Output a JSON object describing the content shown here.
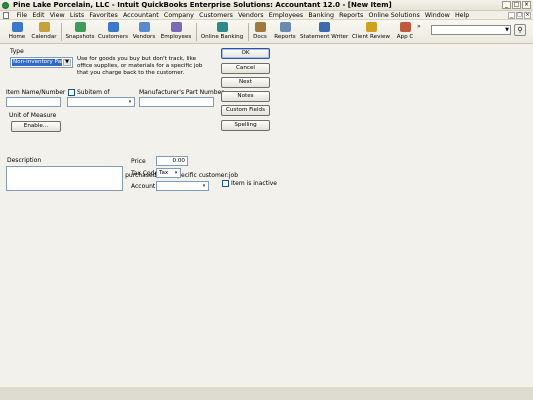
{
  "window": {
    "title": "Pine Lake Porcelain, LLC  -  Intuit QuickBooks Enterprise Solutions: Accountant 12.0 - [New Item]",
    "controls": [
      "_",
      "□",
      "×"
    ],
    "mdi_controls": [
      "_",
      "□",
      "×"
    ]
  },
  "menu": [
    "File",
    "Edit",
    "View",
    "Lists",
    "Favorites",
    "Accountant",
    "Company",
    "Customers",
    "Vendors",
    "Employees",
    "Banking",
    "Reports",
    "Online Solutions",
    "Window",
    "Help"
  ],
  "toolbar": {
    "items": [
      {
        "label": "Home",
        "color": "#3c78c8"
      },
      {
        "label": "Calendar",
        "color": "#c8a03c"
      },
      {
        "label": "Snapshots",
        "color": "#3c9e5a"
      },
      {
        "label": "Customers",
        "color": "#3c7ac8"
      },
      {
        "label": "Vendors",
        "color": "#5a8ad0"
      },
      {
        "label": "Employees",
        "color": "#7a6ab8"
      },
      {
        "label": "Online Banking",
        "color": "#2e8a8a"
      },
      {
        "label": "Docs",
        "color": "#a07a3c"
      },
      {
        "label": "Reports",
        "color": "#6a8ab0"
      },
      {
        "label": "Statement Writer",
        "color": "#3c6ab0"
      },
      {
        "label": "Client Review",
        "color": "#d0a020"
      },
      {
        "label": "App C",
        "color": "#c05a3c"
      }
    ],
    "overflow": "»",
    "search_value": ""
  },
  "form": {
    "type_label": "Type",
    "type_value": "Non-inventory Part",
    "type_description": "Use for goods you buy but don't track, like office supplies, or materials for a specific job that you charge back to the customer.",
    "item_name_label": "Item Name/Number",
    "item_name_value": "",
    "subitem_label": "Subitem of",
    "subitem_value": "",
    "mpn_label": "Manufacturer's Part Number",
    "mpn_value": "",
    "uom_label": "Unit of Measure",
    "enable_button": "Enable...",
    "assembly_checkbox_label": "This item is used in assemblies or is purchased for a specific customer:job",
    "description_label": "Description",
    "description_value": "",
    "price_label": "Price",
    "price_value": "0.00",
    "tax_code_label": "Tax Code",
    "tax_code_value": "Tax",
    "account_label": "Account",
    "account_value": "",
    "inactive_label": "Item is inactive"
  },
  "buttons": {
    "ok": "OK",
    "cancel": "Cancel",
    "next": "Next",
    "notes": "Notes",
    "custom_fields": "Custom Fields",
    "spelling": "Spelling"
  }
}
